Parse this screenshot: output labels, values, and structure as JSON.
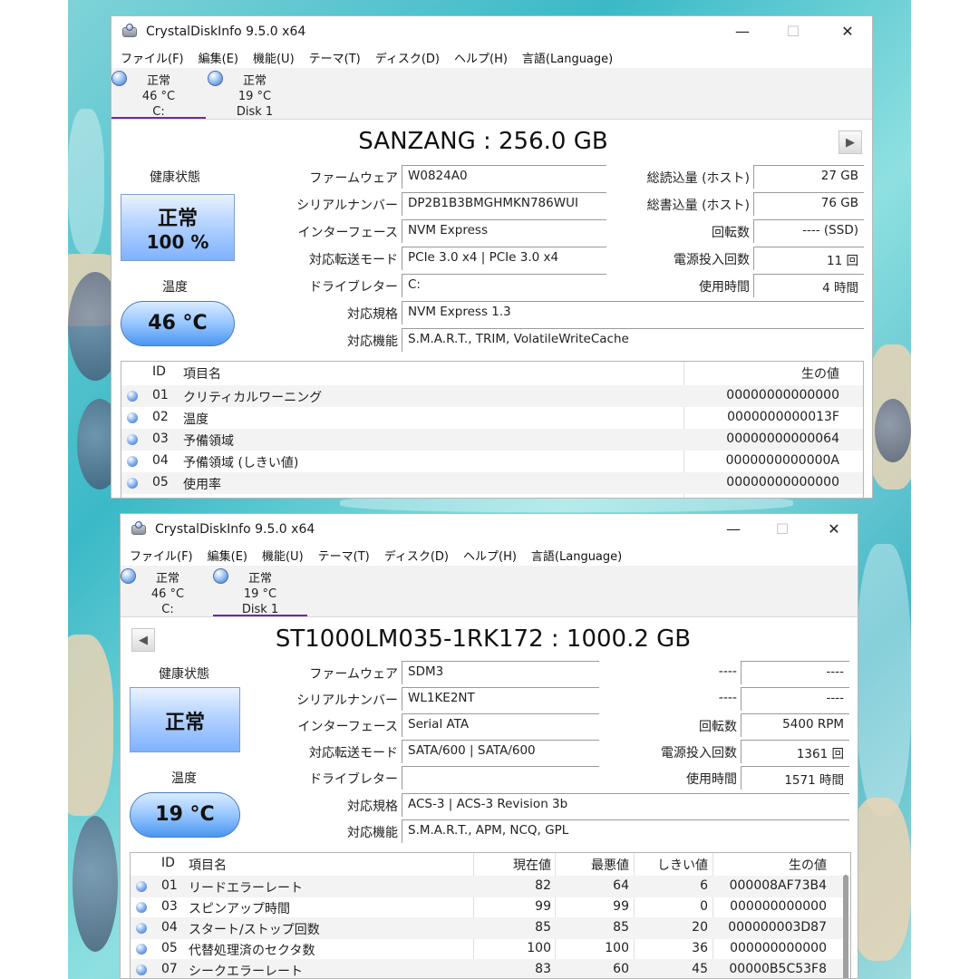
{
  "window_title": "CrystalDiskInfo 9.5.0 x64",
  "window_controls": {
    "minimize": "—",
    "maximize": "☐",
    "close": "✕"
  },
  "menu": [
    "ファイル(F)",
    "編集(E)",
    "機能(U)",
    "テーマ(T)",
    "ディスク(D)",
    "ヘルプ(H)",
    "言語(Language)"
  ],
  "disks": [
    {
      "status": "正常",
      "temp": "46 °C",
      "name": "C:"
    },
    {
      "status": "正常",
      "temp": "19 °C",
      "name": "Disk 1"
    }
  ],
  "labels": {
    "health": "健康状態",
    "temperature": "温度",
    "firmware": "ファームウェア",
    "serial": "シリアルナンバー",
    "interface": "インターフェース",
    "transfer": "対応転送モード",
    "drive_letter": "ドライブレター",
    "standard": "対応規格",
    "features": "対応機能",
    "host_reads": "総読込量 (ホスト)",
    "host_writes": "総書込量 (ホスト)",
    "rotation": "回転数",
    "power_on_count": "電源投入回数",
    "power_on_hours": "使用時間",
    "dash": "----",
    "col_id": "ID",
    "col_name": "項目名",
    "col_current": "現在値",
    "col_worst": "最悪値",
    "col_threshold": "しきい値",
    "col_raw": "生の値"
  },
  "nav": {
    "next": "▶",
    "prev": "◀"
  },
  "top_window": {
    "model": "SANZANG : 256.0 GB",
    "health_status": "正常",
    "health_percent": "100 %",
    "temperature": "46 °C",
    "firmware": "W0824A0",
    "serial": "DP2B1B3BMGHMKN786WUI",
    "interface": "NVM Express",
    "transfer": "PCIe 3.0 x4 | PCIe 3.0 x4",
    "drive_letter": "C:",
    "standard": "NVM Express 1.3",
    "features": "S.M.A.R.T., TRIM, VolatileWriteCache",
    "host_reads": "27 GB",
    "host_writes": "76 GB",
    "rotation": "---- (SSD)",
    "power_on_count": "11 回",
    "power_on_hours": "4 時間",
    "smart": [
      {
        "id": "01",
        "name": "クリティカルワーニング",
        "raw": "00000000000000"
      },
      {
        "id": "02",
        "name": "温度",
        "raw": "0000000000013F"
      },
      {
        "id": "03",
        "name": "予備領域",
        "raw": "00000000000064"
      },
      {
        "id": "04",
        "name": "予備領域 (しきい値)",
        "raw": "0000000000000A"
      },
      {
        "id": "05",
        "name": "使用率",
        "raw": "00000000000000"
      }
    ]
  },
  "bottom_window": {
    "model": "ST1000LM035-1RK172 : 1000.2 GB",
    "health_status": "正常",
    "temperature": "19 °C",
    "firmware": "SDM3",
    "serial": "WL1KE2NT",
    "interface": "Serial ATA",
    "transfer": "SATA/600 | SATA/600",
    "drive_letter": "",
    "standard": "ACS-3 | ACS-3 Revision 3b",
    "features": "S.M.A.R.T., APM, NCQ, GPL",
    "host_reads": "----",
    "host_writes": "----",
    "rotation": "5400 RPM",
    "power_on_count": "1361 回",
    "power_on_hours": "1571 時間",
    "smart": [
      {
        "id": "01",
        "name": "リードエラーレート",
        "current": "82",
        "worst": "64",
        "threshold": "6",
        "raw": "000008AF73B4"
      },
      {
        "id": "03",
        "name": "スピンアップ時間",
        "current": "99",
        "worst": "99",
        "threshold": "0",
        "raw": "000000000000"
      },
      {
        "id": "04",
        "name": "スタート/ストップ回数",
        "current": "85",
        "worst": "85",
        "threshold": "20",
        "raw": "000000003D87"
      },
      {
        "id": "05",
        "name": "代替処理済のセクタ数",
        "current": "100",
        "worst": "100",
        "threshold": "36",
        "raw": "000000000000"
      },
      {
        "id": "07",
        "name": "シークエラーレート",
        "current": "83",
        "worst": "60",
        "threshold": "45",
        "raw": "00000B5C53F8"
      }
    ]
  }
}
